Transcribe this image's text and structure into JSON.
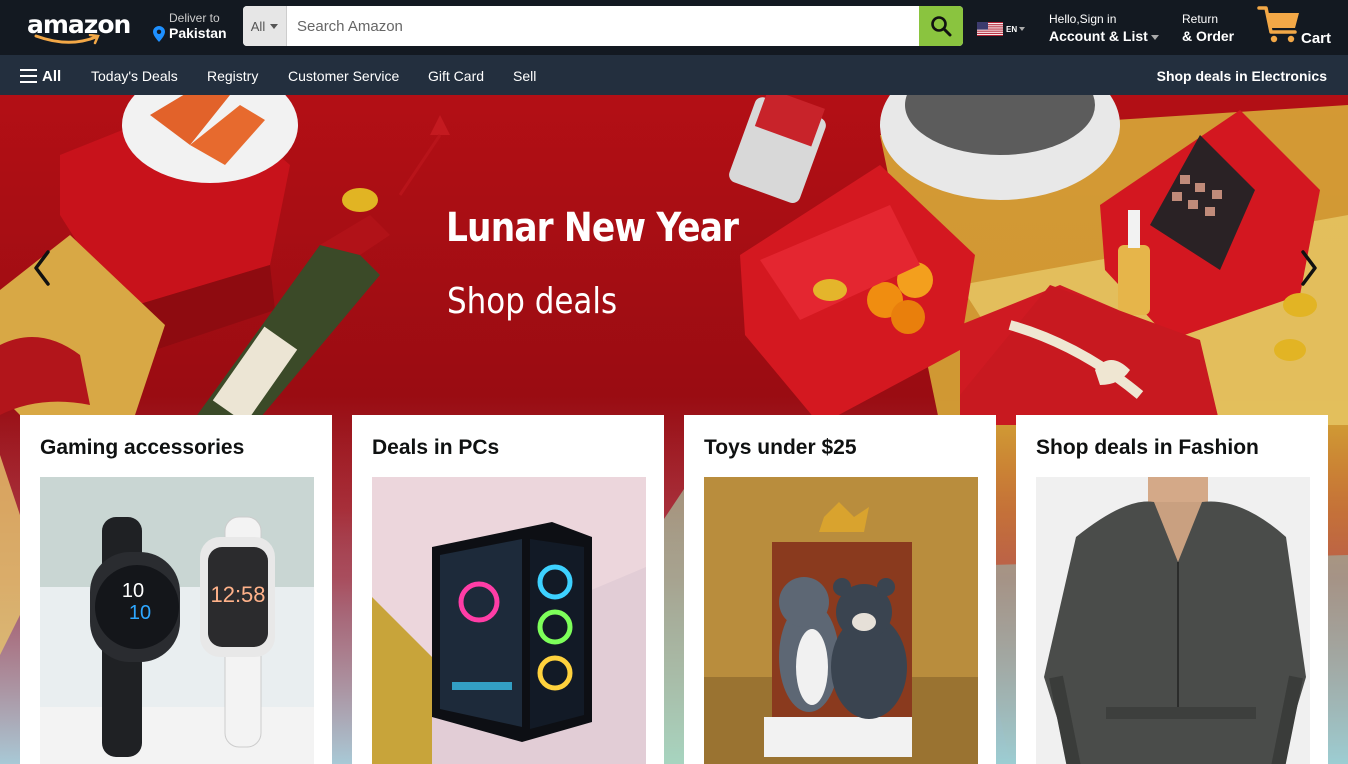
{
  "header": {
    "logo_text": "amazon",
    "deliver_to_label": "Deliver to",
    "deliver_to_location": "Pakistan",
    "search": {
      "category": "All",
      "placeholder": "Search Amazon",
      "value": ""
    },
    "language": "EN",
    "account": {
      "greeting": "Hello,Sign in",
      "label": "Account & List"
    },
    "returns": {
      "line1": "Return",
      "line2": "& Order"
    },
    "cart_label": "Cart"
  },
  "subnav": {
    "all_label": "All",
    "links": [
      "Today's Deals",
      "Registry",
      "Customer Service",
      "Gift Card",
      "Sell"
    ],
    "promo": "Shop deals in Electronics"
  },
  "hero": {
    "title": "Lunar New Year",
    "subtitle": "Shop deals"
  },
  "cards": [
    {
      "title": "Gaming accessories",
      "image": "smartwatches"
    },
    {
      "title": "Deals in PCs",
      "image": "gaming-pc-case"
    },
    {
      "title": "Toys under $25",
      "image": "plush-toys"
    },
    {
      "title": "Shop deals in Fashion",
      "image": "man-in-sweatshirt"
    }
  ],
  "colors": {
    "nav_dark": "#131921",
    "subnav": "#232f3e",
    "search_button": "#8ac43f",
    "cart_accent": "#f3a847",
    "hero_red": "#b30f15"
  }
}
